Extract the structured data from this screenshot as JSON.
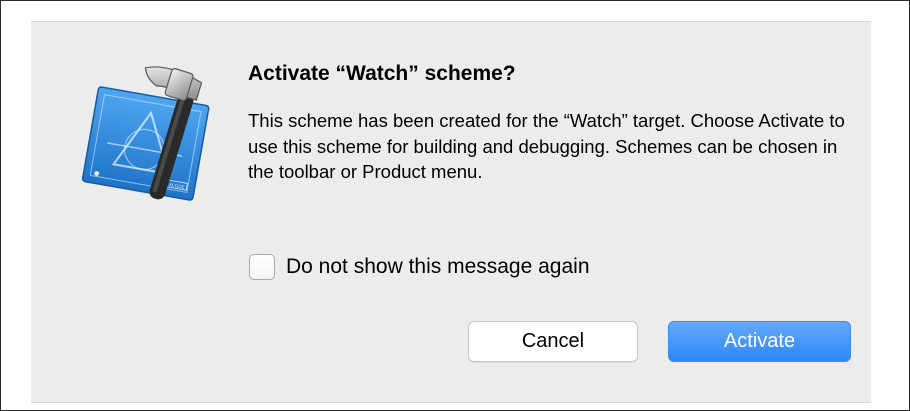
{
  "dialog": {
    "title": "Activate “Watch” scheme?",
    "message": "This scheme has been created for the “Watch” target. Choose Activate to use this scheme for building and debugging. Schemes can be chosen in the toolbar or Product menu.",
    "checkbox": {
      "label": "Do not show this message again",
      "checked": false
    },
    "buttons": {
      "cancel": "Cancel",
      "activate": "Activate"
    },
    "icon": "xcode-app-icon",
    "icon_text": "XCODE",
    "colors": {
      "accent": "#2d86f7",
      "background": "#ececec"
    }
  }
}
